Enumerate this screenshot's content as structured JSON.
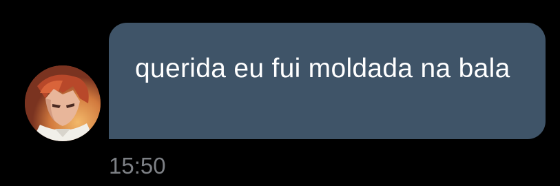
{
  "message": {
    "text": "querida eu fui moldada na bala",
    "timestamp": "15:50",
    "bubble_color": "#3f5468",
    "text_color": "#ffffff",
    "timestamp_color": "#7d8085"
  },
  "sender": {
    "avatar_icon": "user-avatar-icon"
  },
  "theme": {
    "background": "#000000"
  }
}
